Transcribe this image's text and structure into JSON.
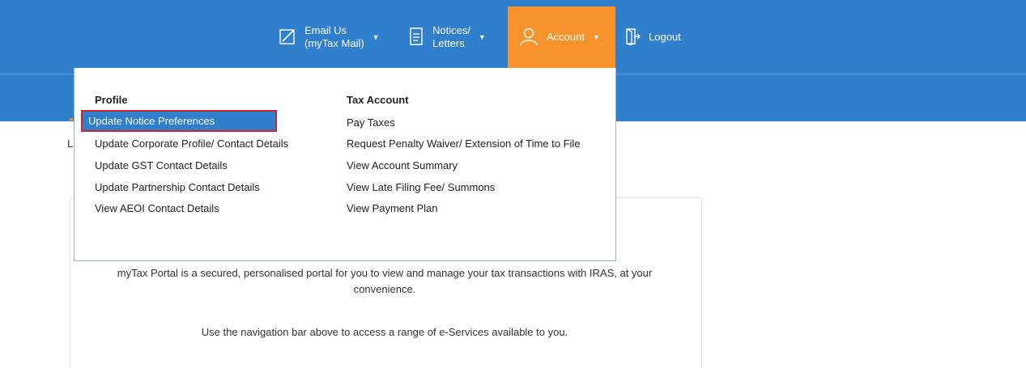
{
  "nav": {
    "email": {
      "line1": "Email Us",
      "line2": "(myTax Mail)",
      "icon": "pencil-icon"
    },
    "notices": {
      "line1": "Notices/",
      "line2": "Letters",
      "icon": "document-icon"
    },
    "account": {
      "label": "Account",
      "icon": "user-icon"
    },
    "logout": {
      "label": "Logout",
      "icon": "logout-door-icon"
    }
  },
  "dropdown": {
    "profile": {
      "heading": "Profile",
      "items": [
        "Update Notice Preferences",
        "Update Corporate Profile/ Contact Details",
        "Update GST Contact Details",
        "Update Partnership Contact Details",
        "View AEOI Contact Details"
      ]
    },
    "tax_account": {
      "heading": "Tax Account",
      "items": [
        "Pay Taxes",
        "Request Penalty Waiver/ Extension of Time to File",
        "View Account Summary",
        "View Late Filing Fee/ Summons",
        "View Payment Plan"
      ]
    }
  },
  "left_stub": "L",
  "main": {
    "intro": "myTax Portal is a secured, personalised portal for you to view and manage your tax transactions with IRAS, at your convenience.",
    "hint": "Use the navigation bar above to access a range of e-Services available to you."
  },
  "colors": {
    "header_blue": "#2f7fcd",
    "account_orange": "#f7932a",
    "highlight_border": "#d3232b"
  }
}
